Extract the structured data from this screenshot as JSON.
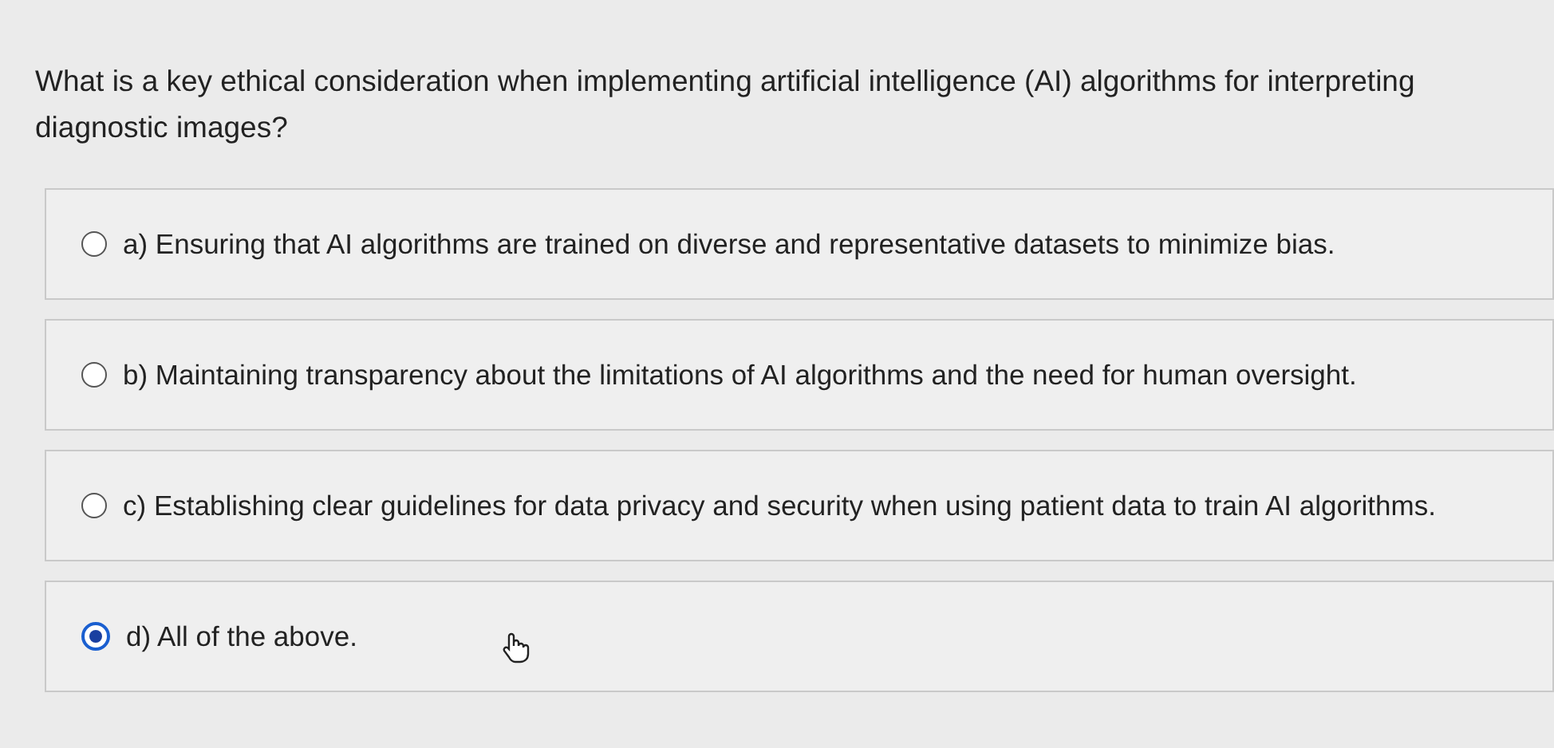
{
  "question": "What is a key ethical consideration when implementing artificial intelligence (AI) algorithms for interpreting diagnostic images?",
  "options": [
    {
      "label": "a) Ensuring that AI algorithms are trained on diverse and representative datasets to minimize bias.",
      "selected": false
    },
    {
      "label": "b) Maintaining transparency about the limitations of AI algorithms and the need for human oversight.",
      "selected": false
    },
    {
      "label": "c) Establishing clear guidelines for data privacy and security when using patient data to train AI algorithms.",
      "selected": false
    },
    {
      "label": "d) All of the above.",
      "selected": true
    }
  ]
}
